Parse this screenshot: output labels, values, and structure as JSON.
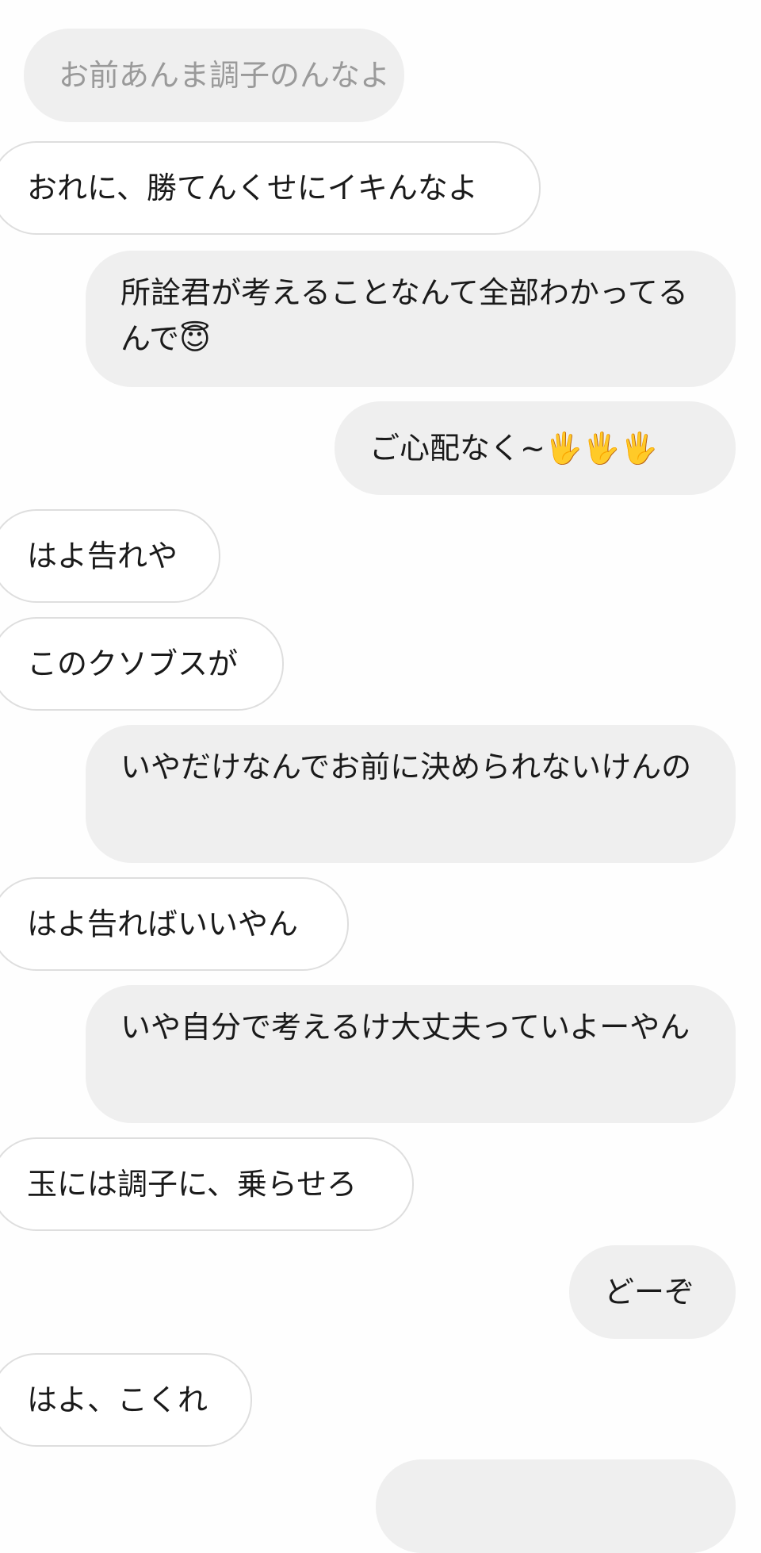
{
  "messages": [
    {
      "from": "other",
      "text": "お前あんま調子のんなよ",
      "faded": true
    },
    {
      "from": "other",
      "text": "おれに、勝てんくせにイキんなよ"
    },
    {
      "from": "me",
      "text": "所詮君が考えることなんて全部わかってるんで😇"
    },
    {
      "from": "me",
      "text": "ご心配なく~🖐🖐🖐"
    },
    {
      "from": "other",
      "text": "はよ告れや"
    },
    {
      "from": "other",
      "text": "このクソブスが"
    },
    {
      "from": "me",
      "text": "いやだけなんでお前に決められないけんの"
    },
    {
      "from": "other",
      "text": "はよ告ればいいやん"
    },
    {
      "from": "me",
      "text": "いや自分で考えるけ大丈夫っていよーやん"
    },
    {
      "from": "other",
      "text": "玉には調子に、乗らせろ"
    },
    {
      "from": "me",
      "text": "どーぞ"
    },
    {
      "from": "other",
      "text": "はよ、こくれ"
    }
  ],
  "colors": {
    "outgoing_bubble": "#efefef",
    "incoming_bubble": "#ffffff",
    "incoming_border": "#dedede",
    "faded_text": "#9a9a9a"
  }
}
